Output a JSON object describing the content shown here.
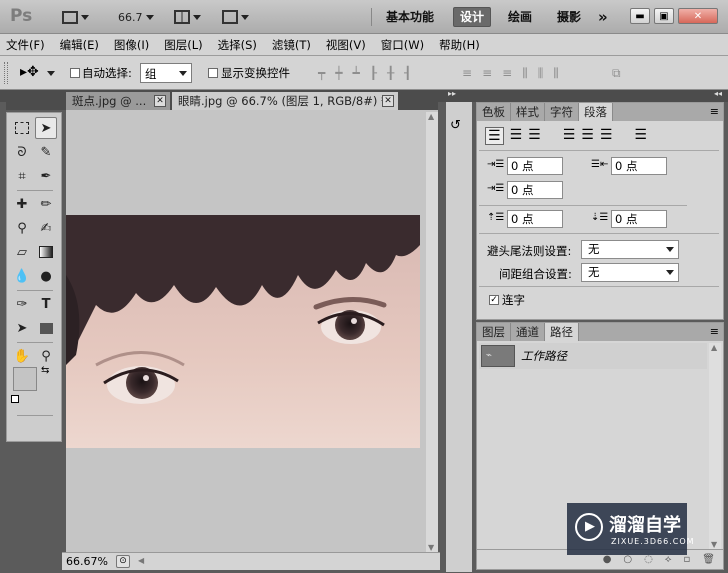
{
  "app": {
    "logo": "Ps",
    "zoom": "66.7"
  },
  "workspaces": {
    "items": [
      "基本功能",
      "设计",
      "绘画",
      "摄影"
    ],
    "more": "»",
    "active_index": 1
  },
  "window_buttons": {
    "min": "▬",
    "restore": "▣",
    "close": "✕"
  },
  "menu": [
    "文件(F)",
    "编辑(E)",
    "图像(I)",
    "图层(L)",
    "选择(S)",
    "滤镜(T)",
    "视图(V)",
    "窗口(W)",
    "帮助(H)"
  ],
  "options": {
    "auto_select_label": "自动选择:",
    "auto_select_value": "组",
    "show_transform_label": "显示变换控件"
  },
  "documents": [
    {
      "title": "斑点.jpg @ ...",
      "close": "✕"
    },
    {
      "title": "眼睛.jpg @ 66.7% (图层 1, RGB/8#) *",
      "close": "✕"
    }
  ],
  "status": {
    "zoom": "66.67%"
  },
  "paragraph_panel": {
    "tabs": [
      "色板",
      "样式",
      "字符",
      "段落"
    ],
    "active_tab": 3,
    "indent_left": "0 点",
    "indent_right": "0 点",
    "first_line": "0 点",
    "space_before": "0 点",
    "space_after": "0 点",
    "kinsoku_label": "避头尾法则设置:",
    "kinsoku_value": "无",
    "mojikumi_label": "间距组合设置:",
    "mojikumi_value": "无",
    "hyphenate_label": "连字",
    "hyphenate_checked": true
  },
  "paths_panel": {
    "tabs": [
      "图层",
      "通道",
      "路径"
    ],
    "active_tab": 2,
    "items": [
      {
        "name": "工作路径"
      }
    ]
  },
  "watermark": {
    "title": "溜溜自学",
    "url": "ZIXUE.3D66.COM"
  },
  "colors": {
    "active_workspace": "#6a6a6a",
    "panel_bg": "#d6d6d6",
    "canvas_bg": "#c5c5c5"
  }
}
